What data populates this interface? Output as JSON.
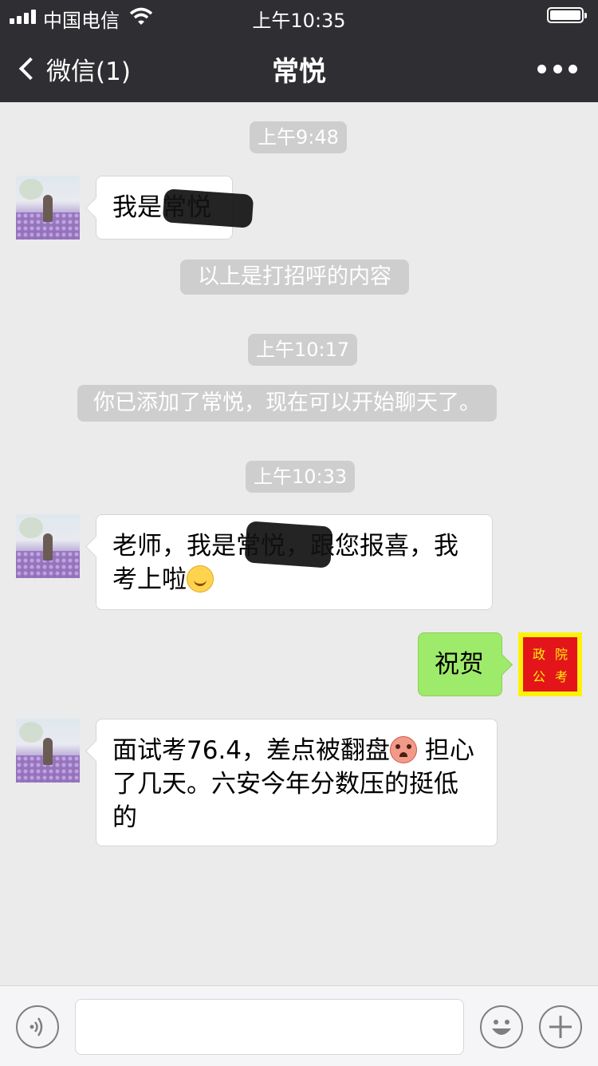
{
  "status_bar": {
    "carrier": "中国电信",
    "time": "上午10:35"
  },
  "nav": {
    "back_label": "微信(1)",
    "title": "常悦"
  },
  "messages": [
    {
      "type": "time",
      "text": "上午9:48"
    },
    {
      "type": "incoming",
      "text": "我是常悦",
      "redacted": true
    },
    {
      "type": "system",
      "text": "以上是打招呼的内容"
    },
    {
      "type": "time",
      "text": "上午10:17"
    },
    {
      "type": "system",
      "text": "你已添加了常悦，现在可以开始聊天了。"
    },
    {
      "type": "time",
      "text": "上午10:33"
    },
    {
      "type": "incoming",
      "line1": "老师，我是常悦，跟您报喜，我",
      "line2": "考上啦",
      "emoji": "smile-emoji",
      "redacted": true
    },
    {
      "type": "outgoing",
      "text": "祝贺"
    },
    {
      "type": "incoming",
      "line1a": "面试考76.4，差点被翻盘",
      "line1b": "担心",
      "line2": "了几天。六安今年分数压的挺低",
      "line3": "的",
      "emoji": "scared-emoji"
    }
  ],
  "my_avatar_seal": {
    "c1": "政",
    "c2": "院",
    "c3": "公",
    "c4": "考"
  },
  "colors": {
    "nav_bg": "#2f2f33",
    "chat_bg": "#ebebeb",
    "outgoing_bubble": "#9eea6a",
    "seal_red": "#e3151a",
    "seal_yellow": "#fff20a"
  }
}
